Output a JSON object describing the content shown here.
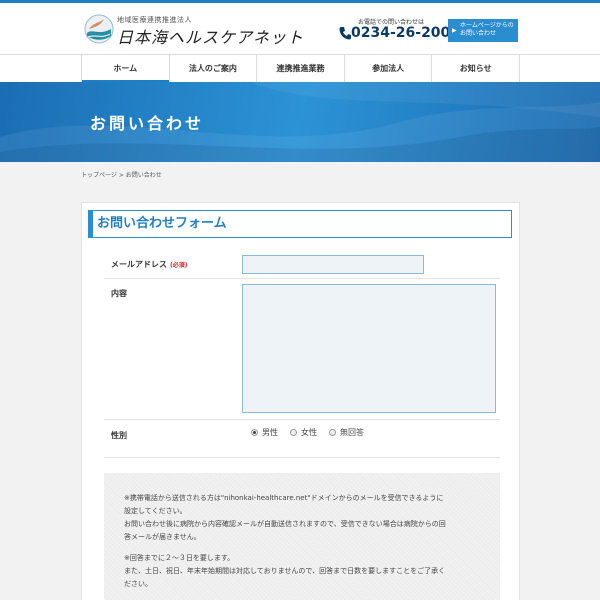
{
  "header": {
    "logo_subtitle": "地域医療連携推進法人",
    "logo_title": "日本海ヘルスケアネット",
    "contact_label": "お電話での問い合わせは",
    "phone_number": "0234-26-2001",
    "homepage_button_line1": "ホームページからの",
    "homepage_button_line2": "お問い合わせ"
  },
  "nav": {
    "items": [
      {
        "label": "ホーム"
      },
      {
        "label": "法人のご案内"
      },
      {
        "label": "連携推進業務"
      },
      {
        "label": "参加法人"
      },
      {
        "label": "お知らせ"
      }
    ]
  },
  "hero": {
    "title": "お問い合わせ"
  },
  "breadcrumb": {
    "home": "トップページ",
    "separator": ">",
    "current": "お問い合わせ"
  },
  "form": {
    "heading": "お問い合わせフォーム",
    "email_label": "メールアドレス",
    "required_badge": "(必須)",
    "email_value": "",
    "body_label": "内容",
    "body_value": "",
    "gender_label": "性別",
    "gender_options": [
      "男性",
      "女性",
      "無回答"
    ],
    "gender_selected": "男性"
  },
  "notes": {
    "note1_line1": "※携帯電話から送信される方は\"nihonkai-healthcare.net\"ドメインからのメールを受信できるように",
    "note1_line2": "設定してください。",
    "note1_line3": "お問い合わせ後に病院から内容確認メールが自動送信されますので、受信できない場合は病院からの回",
    "note1_line4": "答メールが届きません。",
    "note2_line1": "※回答までに２～３日を要します。",
    "note2_line2": "また、土日、祝日、年末年始期間は対応しておりませんので、回答まで日数を要しますことをご了承く",
    "note2_line3": "ださい。"
  },
  "colors": {
    "accent": "#1e7fc4",
    "required": "#c9262a",
    "hero_start": "#1b6db3",
    "hero_end": "#2c93d6"
  }
}
